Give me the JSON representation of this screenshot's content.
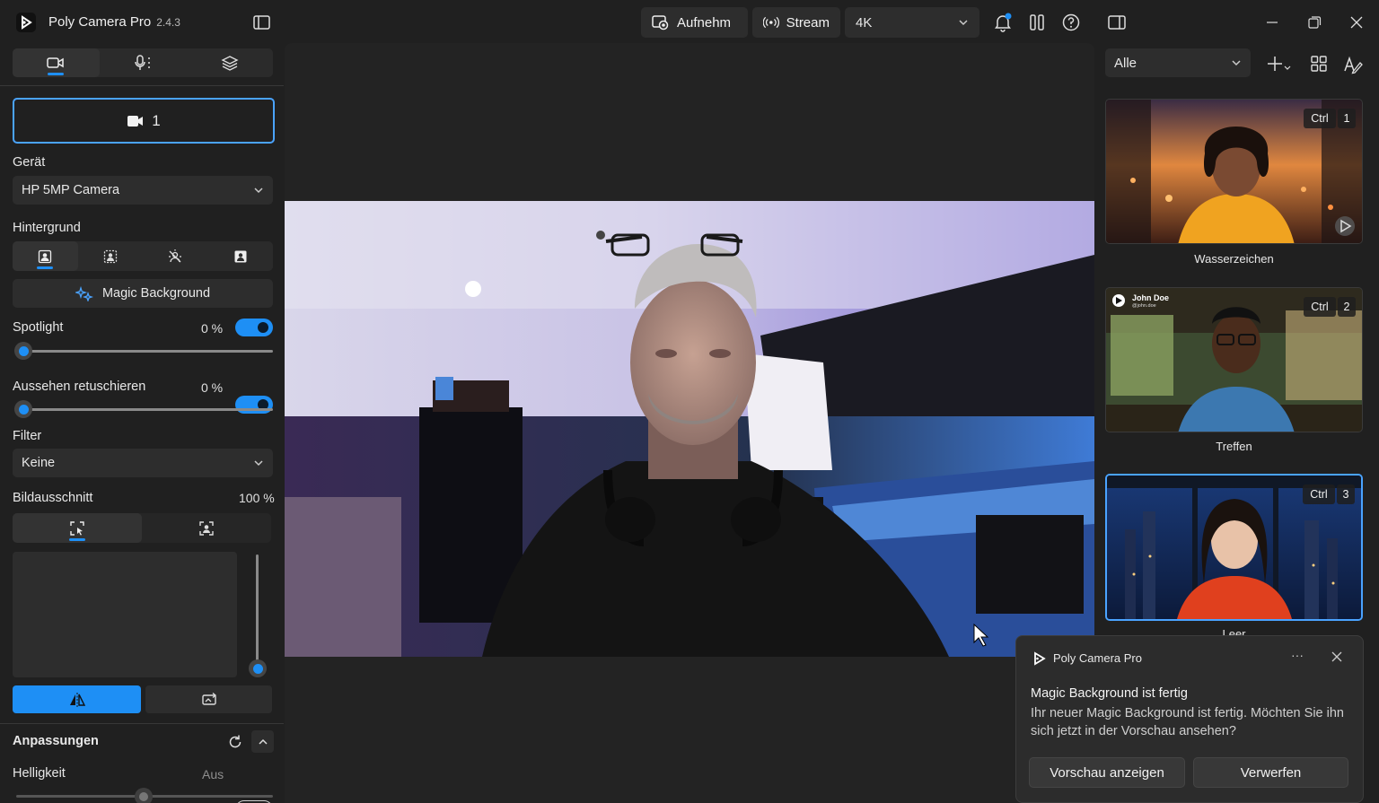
{
  "app": {
    "name": "Poly Camera Pro",
    "version": "2.4.3"
  },
  "toolbar": {
    "record_label": "Aufnehm",
    "stream_label": "Stream",
    "resolution": "4K"
  },
  "left": {
    "camera_label": "1",
    "device": {
      "label": "Gerät",
      "value": "HP 5MP Camera"
    },
    "background": {
      "label": "Hintergrund",
      "magic_label": "Magic Background"
    },
    "spotlight": {
      "label": "Spotlight",
      "value": "0 %"
    },
    "retouch": {
      "label": "Aussehen retuschieren",
      "value": "0 %"
    },
    "filter": {
      "label": "Filter",
      "value": "Keine"
    },
    "crop": {
      "label": "Bildausschnitt",
      "value": "100 %"
    },
    "adjust": {
      "label": "Anpassungen"
    },
    "brightness": {
      "label": "Helligkeit",
      "state": "Aus"
    }
  },
  "right": {
    "filter_value": "Alle",
    "scenes": [
      {
        "name": "Wasserzeichen",
        "ctrl": "Ctrl",
        "key": "1"
      },
      {
        "name": "Treffen",
        "ctrl": "Ctrl",
        "key": "2",
        "badge_name": "John Doe",
        "badge_sub": "@john.doe"
      },
      {
        "name": "Leer",
        "ctrl": "Ctrl",
        "key": "3"
      }
    ]
  },
  "toast": {
    "app_name": "Poly Camera Pro",
    "more": "···",
    "title": "Magic Background ist fertig",
    "body": "Ihr neuer Magic Background ist fertig. Möchten Sie ihn sich jetzt in der Vorschau ansehen?",
    "preview_label": "Vorschau anzeigen",
    "discard_label": "Verwerfen"
  },
  "colors": {
    "accent": "#1e8ff5",
    "bg": "#202020",
    "panel": "#2d2d2d"
  }
}
